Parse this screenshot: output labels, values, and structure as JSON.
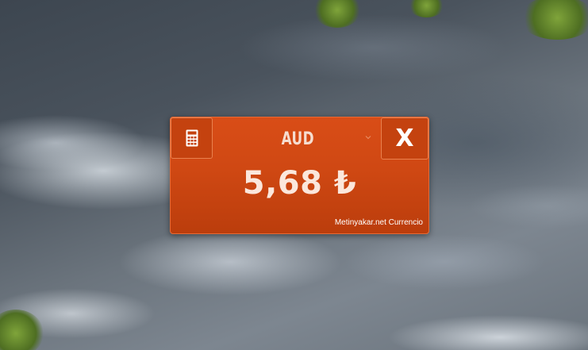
{
  "widget": {
    "currency_code": "AUD",
    "rate": "5,68 ₺",
    "close_label": "X",
    "brand": "Metinyakar.net Currencio"
  },
  "icons": {
    "calculator": "calculator-icon",
    "dropdown": "chevron-down-icon"
  },
  "colors": {
    "widget_background": "#d04a14",
    "button_border": "#e9814e",
    "text": "#fbe7dc"
  }
}
